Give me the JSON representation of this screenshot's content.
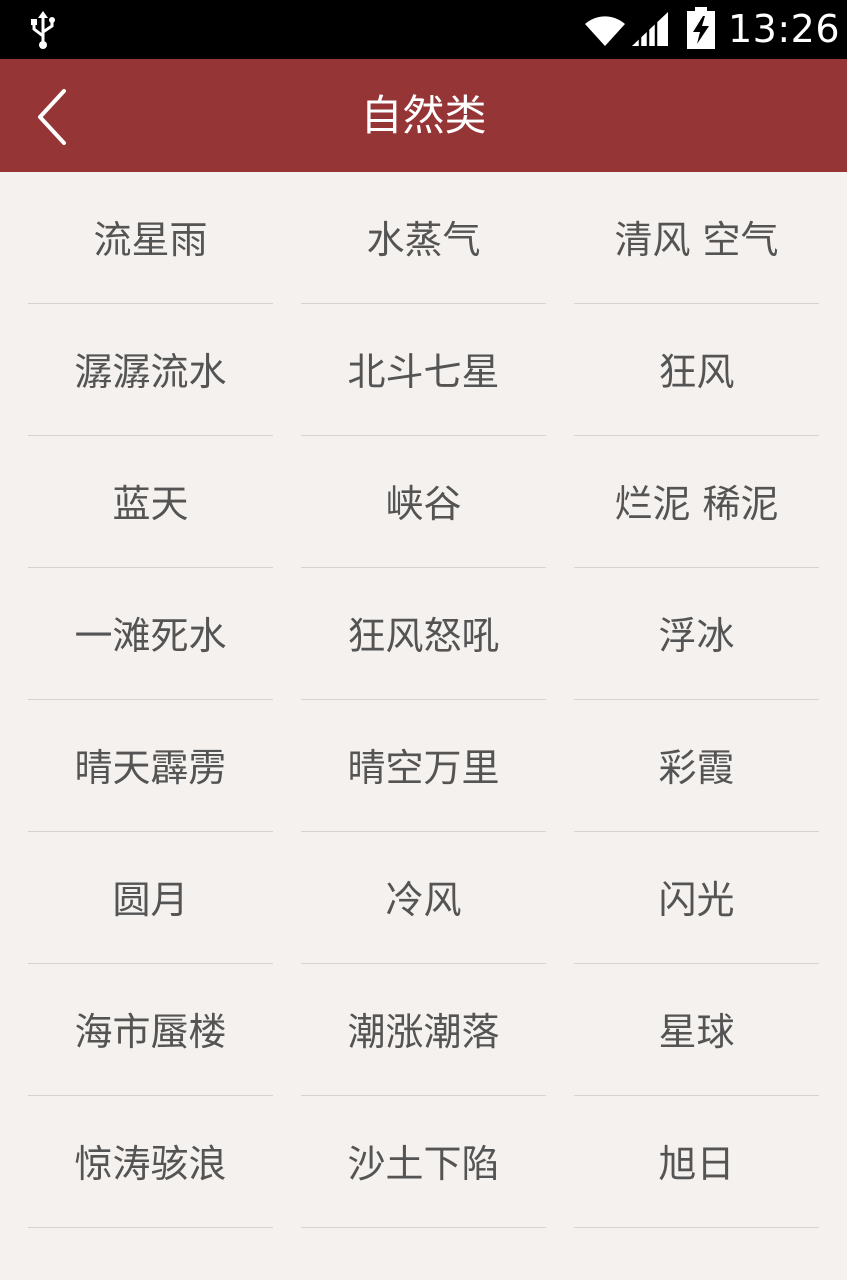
{
  "status_bar": {
    "time": "13:26",
    "icons": [
      "usb-icon",
      "wifi-icon",
      "cell-signal-icon",
      "battery-charging-icon"
    ]
  },
  "header": {
    "title": "自然类",
    "back_icon": "chevron-left-icon"
  },
  "colors": {
    "header_bg": "#953536",
    "page_bg": "#f4f1ee",
    "item_text": "#545454",
    "divider": "#d6d2cf"
  },
  "items": [
    "流星雨",
    "水蒸气",
    "清风 空气",
    "潺潺流水",
    "北斗七星",
    "狂风",
    "蓝天",
    "峡谷",
    "烂泥 稀泥",
    "一滩死水",
    "狂风怒吼",
    "浮冰",
    "晴天霹雳",
    "晴空万里",
    "彩霞",
    "圆月",
    "冷风",
    "闪光",
    "海市蜃楼",
    "潮涨潮落",
    "星球",
    "惊涛骇浪",
    "沙土下陷",
    "旭日"
  ]
}
